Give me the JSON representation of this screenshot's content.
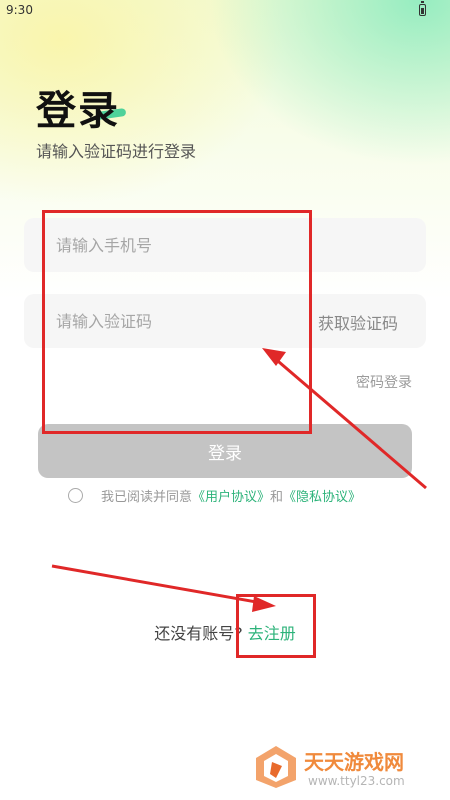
{
  "status_bar": {
    "time": "9:30"
  },
  "header": {
    "title": "登录",
    "subtitle": "请输入验证码进行登录"
  },
  "form": {
    "phone_placeholder": "请输入手机号",
    "code_placeholder": "请输入验证码",
    "get_code_label": "获取验证码",
    "password_login_label": "密码登录",
    "login_button_label": "登录"
  },
  "agreement": {
    "prefix": "我已阅读并同意",
    "user_agreement": "《用户协议》",
    "connector": "和",
    "privacy_policy": "《隐私协议》"
  },
  "register": {
    "prompt": "还没有账号?",
    "link": "去注册"
  },
  "watermark": {
    "name": "天天游戏网",
    "url": "www.ttyl23.com"
  },
  "colors": {
    "accent": "#2db37a",
    "annotation": "#e02828",
    "button_disabled": "#c4c4c4"
  }
}
